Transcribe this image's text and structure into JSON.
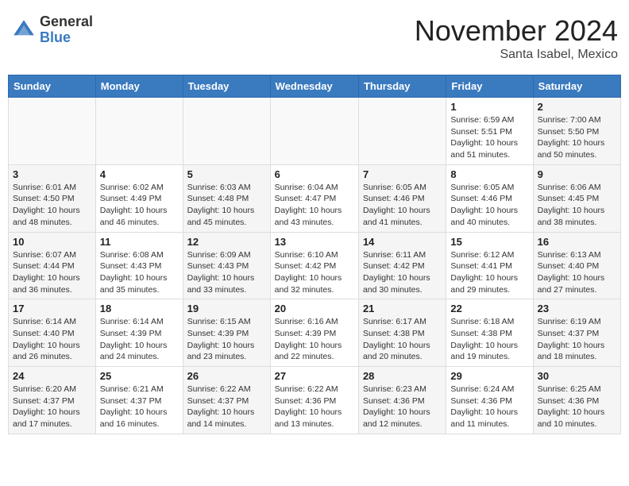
{
  "header": {
    "logo_general": "General",
    "logo_blue": "Blue",
    "month_title": "November 2024",
    "subtitle": "Santa Isabel, Mexico"
  },
  "days_of_week": [
    "Sunday",
    "Monday",
    "Tuesday",
    "Wednesday",
    "Thursday",
    "Friday",
    "Saturday"
  ],
  "weeks": [
    {
      "days": [
        {
          "number": "",
          "info": ""
        },
        {
          "number": "",
          "info": ""
        },
        {
          "number": "",
          "info": ""
        },
        {
          "number": "",
          "info": ""
        },
        {
          "number": "",
          "info": ""
        },
        {
          "number": "1",
          "info": "Sunrise: 6:59 AM\nSunset: 5:51 PM\nDaylight: 10 hours\nand 51 minutes."
        },
        {
          "number": "2",
          "info": "Sunrise: 7:00 AM\nSunset: 5:50 PM\nDaylight: 10 hours\nand 50 minutes."
        }
      ]
    },
    {
      "days": [
        {
          "number": "3",
          "info": "Sunrise: 6:01 AM\nSunset: 4:50 PM\nDaylight: 10 hours\nand 48 minutes."
        },
        {
          "number": "4",
          "info": "Sunrise: 6:02 AM\nSunset: 4:49 PM\nDaylight: 10 hours\nand 46 minutes."
        },
        {
          "number": "5",
          "info": "Sunrise: 6:03 AM\nSunset: 4:48 PM\nDaylight: 10 hours\nand 45 minutes."
        },
        {
          "number": "6",
          "info": "Sunrise: 6:04 AM\nSunset: 4:47 PM\nDaylight: 10 hours\nand 43 minutes."
        },
        {
          "number": "7",
          "info": "Sunrise: 6:05 AM\nSunset: 4:46 PM\nDaylight: 10 hours\nand 41 minutes."
        },
        {
          "number": "8",
          "info": "Sunrise: 6:05 AM\nSunset: 4:46 PM\nDaylight: 10 hours\nand 40 minutes."
        },
        {
          "number": "9",
          "info": "Sunrise: 6:06 AM\nSunset: 4:45 PM\nDaylight: 10 hours\nand 38 minutes."
        }
      ]
    },
    {
      "days": [
        {
          "number": "10",
          "info": "Sunrise: 6:07 AM\nSunset: 4:44 PM\nDaylight: 10 hours\nand 36 minutes."
        },
        {
          "number": "11",
          "info": "Sunrise: 6:08 AM\nSunset: 4:43 PM\nDaylight: 10 hours\nand 35 minutes."
        },
        {
          "number": "12",
          "info": "Sunrise: 6:09 AM\nSunset: 4:43 PM\nDaylight: 10 hours\nand 33 minutes."
        },
        {
          "number": "13",
          "info": "Sunrise: 6:10 AM\nSunset: 4:42 PM\nDaylight: 10 hours\nand 32 minutes."
        },
        {
          "number": "14",
          "info": "Sunrise: 6:11 AM\nSunset: 4:42 PM\nDaylight: 10 hours\nand 30 minutes."
        },
        {
          "number": "15",
          "info": "Sunrise: 6:12 AM\nSunset: 4:41 PM\nDaylight: 10 hours\nand 29 minutes."
        },
        {
          "number": "16",
          "info": "Sunrise: 6:13 AM\nSunset: 4:40 PM\nDaylight: 10 hours\nand 27 minutes."
        }
      ]
    },
    {
      "days": [
        {
          "number": "17",
          "info": "Sunrise: 6:14 AM\nSunset: 4:40 PM\nDaylight: 10 hours\nand 26 minutes."
        },
        {
          "number": "18",
          "info": "Sunrise: 6:14 AM\nSunset: 4:39 PM\nDaylight: 10 hours\nand 24 minutes."
        },
        {
          "number": "19",
          "info": "Sunrise: 6:15 AM\nSunset: 4:39 PM\nDaylight: 10 hours\nand 23 minutes."
        },
        {
          "number": "20",
          "info": "Sunrise: 6:16 AM\nSunset: 4:39 PM\nDaylight: 10 hours\nand 22 minutes."
        },
        {
          "number": "21",
          "info": "Sunrise: 6:17 AM\nSunset: 4:38 PM\nDaylight: 10 hours\nand 20 minutes."
        },
        {
          "number": "22",
          "info": "Sunrise: 6:18 AM\nSunset: 4:38 PM\nDaylight: 10 hours\nand 19 minutes."
        },
        {
          "number": "23",
          "info": "Sunrise: 6:19 AM\nSunset: 4:37 PM\nDaylight: 10 hours\nand 18 minutes."
        }
      ]
    },
    {
      "days": [
        {
          "number": "24",
          "info": "Sunrise: 6:20 AM\nSunset: 4:37 PM\nDaylight: 10 hours\nand 17 minutes."
        },
        {
          "number": "25",
          "info": "Sunrise: 6:21 AM\nSunset: 4:37 PM\nDaylight: 10 hours\nand 16 minutes."
        },
        {
          "number": "26",
          "info": "Sunrise: 6:22 AM\nSunset: 4:37 PM\nDaylight: 10 hours\nand 14 minutes."
        },
        {
          "number": "27",
          "info": "Sunrise: 6:22 AM\nSunset: 4:36 PM\nDaylight: 10 hours\nand 13 minutes."
        },
        {
          "number": "28",
          "info": "Sunrise: 6:23 AM\nSunset: 4:36 PM\nDaylight: 10 hours\nand 12 minutes."
        },
        {
          "number": "29",
          "info": "Sunrise: 6:24 AM\nSunset: 4:36 PM\nDaylight: 10 hours\nand 11 minutes."
        },
        {
          "number": "30",
          "info": "Sunrise: 6:25 AM\nSunset: 4:36 PM\nDaylight: 10 hours\nand 10 minutes."
        }
      ]
    }
  ]
}
